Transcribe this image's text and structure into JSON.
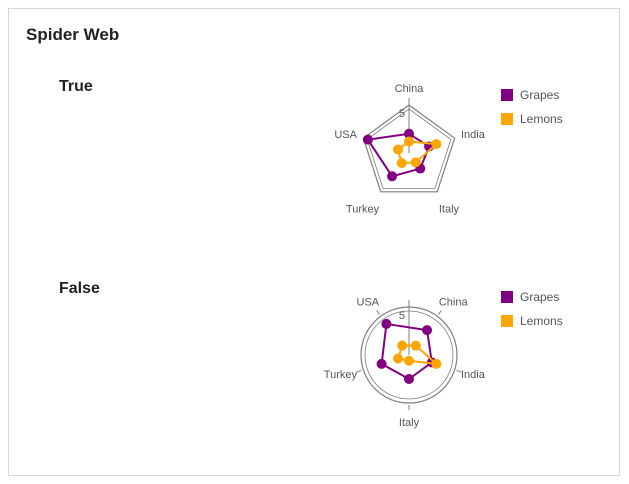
{
  "page": {
    "title": "Spider Web",
    "sections": [
      "True",
      "False"
    ]
  },
  "colors": {
    "grapes": "#800080",
    "lemons": "#ffa500",
    "grid": "#7f7f7f"
  },
  "chart_data": [
    {
      "type": "radar",
      "grid_shape": "polygon",
      "categories": [
        "China",
        "India",
        "Italy",
        "Turkey",
        "USA"
      ],
      "max_tick_label": "5",
      "rmax": 5,
      "series": [
        {
          "name": "Grapes",
          "values": [
            2,
            2.2,
            2,
            3,
            4.5
          ]
        },
        {
          "name": "Lemons",
          "values": [
            1.2,
            3,
            1.2,
            1.3,
            1.2
          ]
        }
      ],
      "legend": [
        "Grapes",
        "Lemons"
      ],
      "legend_position": "right"
    },
    {
      "type": "radar",
      "grid_shape": "circle",
      "categories": [
        "USA",
        "China",
        "India",
        "Italy",
        "Turkey"
      ],
      "max_tick_label": "5",
      "rmax": 5,
      "series": [
        {
          "name": "Grapes",
          "values": [
            4,
            3.2,
            2.5,
            2.5,
            3
          ]
        },
        {
          "name": "Lemons",
          "values": [
            1.2,
            1.2,
            3,
            0.6,
            1.2
          ]
        }
      ],
      "legend": [
        "Grapes",
        "Lemons"
      ],
      "legend_position": "right"
    }
  ]
}
